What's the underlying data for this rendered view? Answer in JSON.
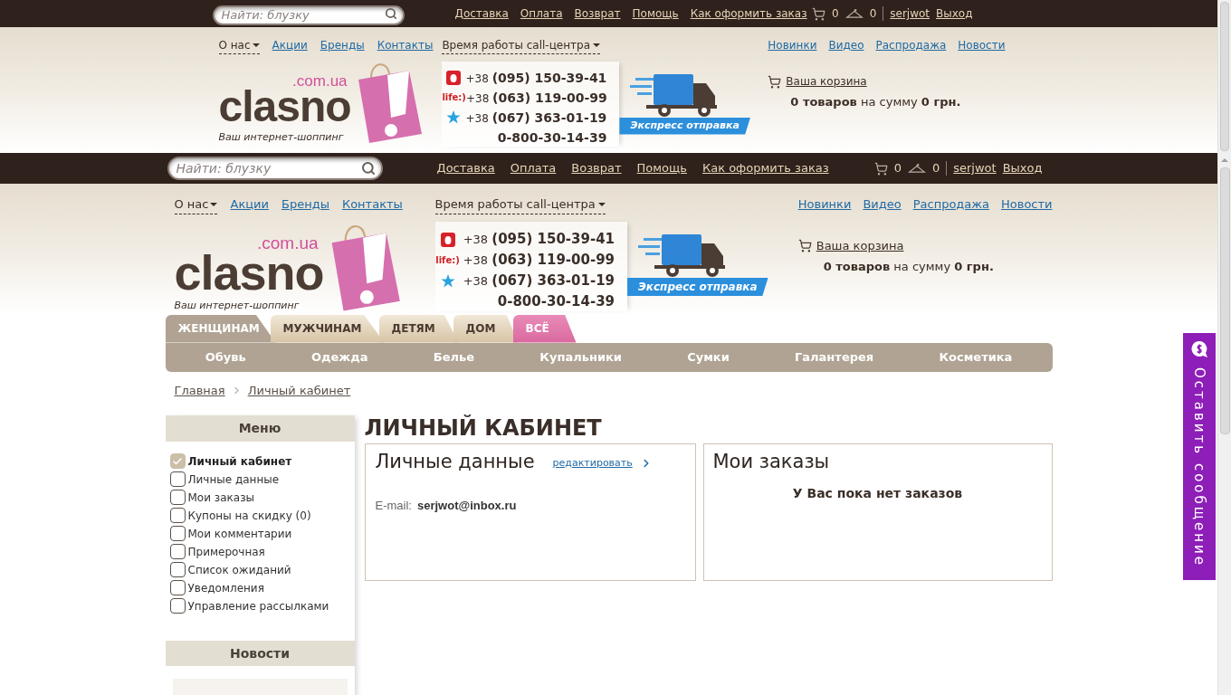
{
  "sticky_header": {
    "search": {
      "placeholder": "Найти: блузку"
    },
    "top_links": [
      "Доставка",
      "Оплата",
      "Возврат",
      "Помощь",
      "Как оформить заказ"
    ],
    "cart_count": "0",
    "wishlist_count": "0",
    "user": "serjwot",
    "logout": "Выход",
    "info_menus": [
      {
        "label": "О нас",
        "kind": "dropdown"
      },
      {
        "label": "Акции",
        "kind": "link"
      },
      {
        "label": "Бренды",
        "kind": "link"
      },
      {
        "label": "Контакты",
        "kind": "link"
      }
    ],
    "call_center": "Время работы call-центра",
    "right_links": [
      "Новинки",
      "Видео",
      "Распродажа",
      "Новости"
    ],
    "logo": {
      "domain": ".com.ua",
      "name": "clasno",
      "tagline": "Ваш интернет-шоппинг"
    },
    "phones": [
      {
        "kind": "red",
        "prefix": "+38",
        "number": "(095) 150-39-41"
      },
      {
        "kind": "life",
        "badge": "life:)",
        "prefix": "+38",
        "number": "(063) 119-00-99"
      },
      {
        "kind": "star",
        "prefix": "+38",
        "number": "(067) 363-01-19"
      },
      {
        "kind": "plain",
        "number": "0-800-30-14-39"
      }
    ],
    "delivery_badge": "Экспресс отправка",
    "cart": {
      "link": "Ваша корзина",
      "summary": "**0 товаров** на сумму **0 грн.**"
    }
  },
  "header": {
    "search": {
      "placeholder": "Найти: блузку"
    },
    "top_links": [
      "Доставка",
      "Оплата",
      "Возврат",
      "Помощь",
      "Как оформить заказ"
    ],
    "cart_count": "0",
    "wishlist_count": "0",
    "user": "serjwot",
    "logout": "Выход",
    "info_menus": [
      {
        "label": "О нас",
        "kind": "dropdown"
      },
      {
        "label": "Акции",
        "kind": "link"
      },
      {
        "label": "Бренды",
        "kind": "link"
      },
      {
        "label": "Контакты",
        "kind": "link"
      }
    ],
    "call_center": "Время работы call-центра",
    "right_links": [
      "Новинки",
      "Видео",
      "Распродажа",
      "Новости"
    ],
    "logo": {
      "domain": ".com.ua",
      "name": "clasno",
      "tagline": "Ваш интернет-шоппинг"
    },
    "phones": [
      {
        "kind": "red",
        "prefix": "+38",
        "number": "(095) 150-39-41"
      },
      {
        "kind": "life",
        "badge": "life:)",
        "prefix": "+38",
        "number": "(063) 119-00-99"
      },
      {
        "kind": "star",
        "prefix": "+38",
        "number": "(067) 363-01-19"
      },
      {
        "kind": "plain",
        "number": "0-800-30-14-39"
      }
    ],
    "delivery_badge": "Экспресс отправка",
    "cart": {
      "link": "Ваша корзина",
      "summary": "**0 товаров** на сумму **0 грн.**"
    }
  },
  "category_tabs": [
    {
      "label": "ЖЕНЩИНАМ",
      "kind": "section",
      "selected": true
    },
    {
      "label": "МУЖЧИНАМ",
      "kind": "section",
      "selected": false
    },
    {
      "label": "ДЕТЯМ",
      "kind": "section",
      "selected": false
    },
    {
      "label": "ДОМ",
      "kind": "section",
      "selected": false
    },
    {
      "label": "ВСЁ",
      "kind": "all",
      "selected": false
    }
  ],
  "subcategories": [
    "Обувь",
    "Одежда",
    "Белье",
    "Купальники",
    "Сумки",
    "Галантерея",
    "Косметика"
  ],
  "breadcrumbs": [
    "Главная",
    "Личный кабинет"
  ],
  "sidebar": {
    "menu_title": "Меню",
    "menu_items": [
      {
        "label": "Личный кабинет",
        "checked": true
      },
      {
        "label": "Личные данные",
        "checked": false
      },
      {
        "label": "Мои заказы",
        "checked": false
      },
      {
        "label": "Купоны на скидку (0)",
        "checked": false
      },
      {
        "label": "Мои комментарии",
        "checked": false
      },
      {
        "label": "Примерочная",
        "checked": false
      },
      {
        "label": "Список ожиданий",
        "checked": false
      },
      {
        "label": "Уведомления",
        "checked": false
      },
      {
        "label": "Управление рассылками",
        "checked": false
      }
    ],
    "news_title": "Новости"
  },
  "page_title": "ЛИЧНЫЙ КАБИНЕТ",
  "personal_data": {
    "title": "Личные данные",
    "edit_link": "редактировать",
    "email_label": "E-mail:",
    "email": "serjwot@inbox.ru"
  },
  "orders": {
    "title": "Мои заказы",
    "empty_message": "У Вас пока нет заказов"
  },
  "feedback_tab": {
    "label": "Оставить сообщение"
  }
}
